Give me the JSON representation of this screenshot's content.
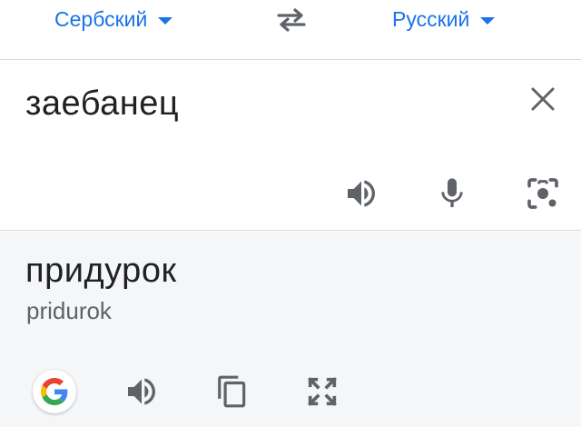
{
  "languages": {
    "source": "Сербский",
    "target": "Русский"
  },
  "source": {
    "text": "заебанец"
  },
  "target": {
    "text": "придурок",
    "transliteration": "pridurok"
  },
  "icons": {
    "swap": "swap-languages-icon",
    "clear": "close-icon",
    "speaker": "speaker-icon",
    "microphone": "microphone-icon",
    "camera": "camera-icon",
    "google": "google-logo-icon",
    "copy": "copy-icon",
    "fullscreen": "fullscreen-icon"
  },
  "colors": {
    "accent": "#1a73e8",
    "icon": "#5f6368",
    "text": "#202124",
    "result_background": "#f5f6f8"
  }
}
